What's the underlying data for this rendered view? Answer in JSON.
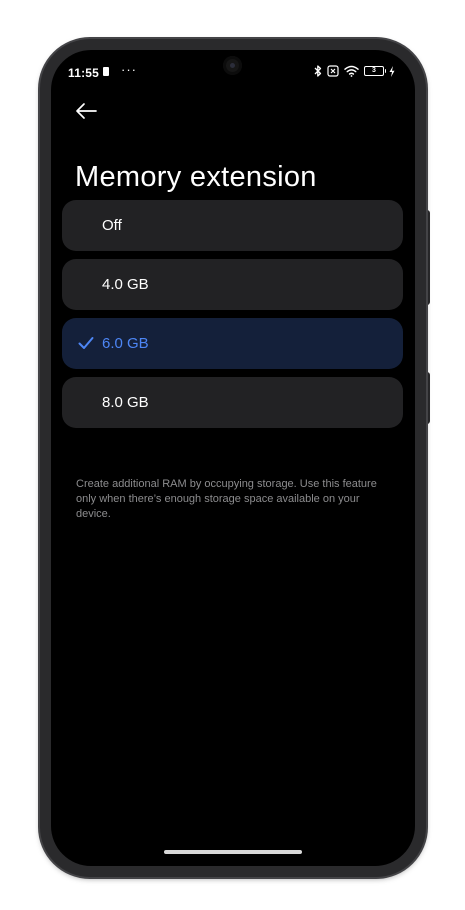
{
  "status_bar": {
    "time": "11:55",
    "dots": "···",
    "battery_level": "3",
    "icons": [
      "bluetooth-icon",
      "no-sim-icon",
      "wifi-icon",
      "battery-icon",
      "charging-icon"
    ]
  },
  "header": {
    "back_icon": "arrow-left-icon",
    "title": "Memory extension"
  },
  "options": [
    {
      "label": "Off",
      "selected": false
    },
    {
      "label": "4.0 GB",
      "selected": false
    },
    {
      "label": "6.0 GB",
      "selected": true
    },
    {
      "label": "8.0 GB",
      "selected": false
    }
  ],
  "description": "Create additional RAM by occupying storage. Use this feature only when there’s enough storage space available on your device.",
  "colors": {
    "accent": "#4d86f5",
    "selected_bg": "#14203a",
    "option_bg": "#222224",
    "screen_bg": "#000000"
  }
}
